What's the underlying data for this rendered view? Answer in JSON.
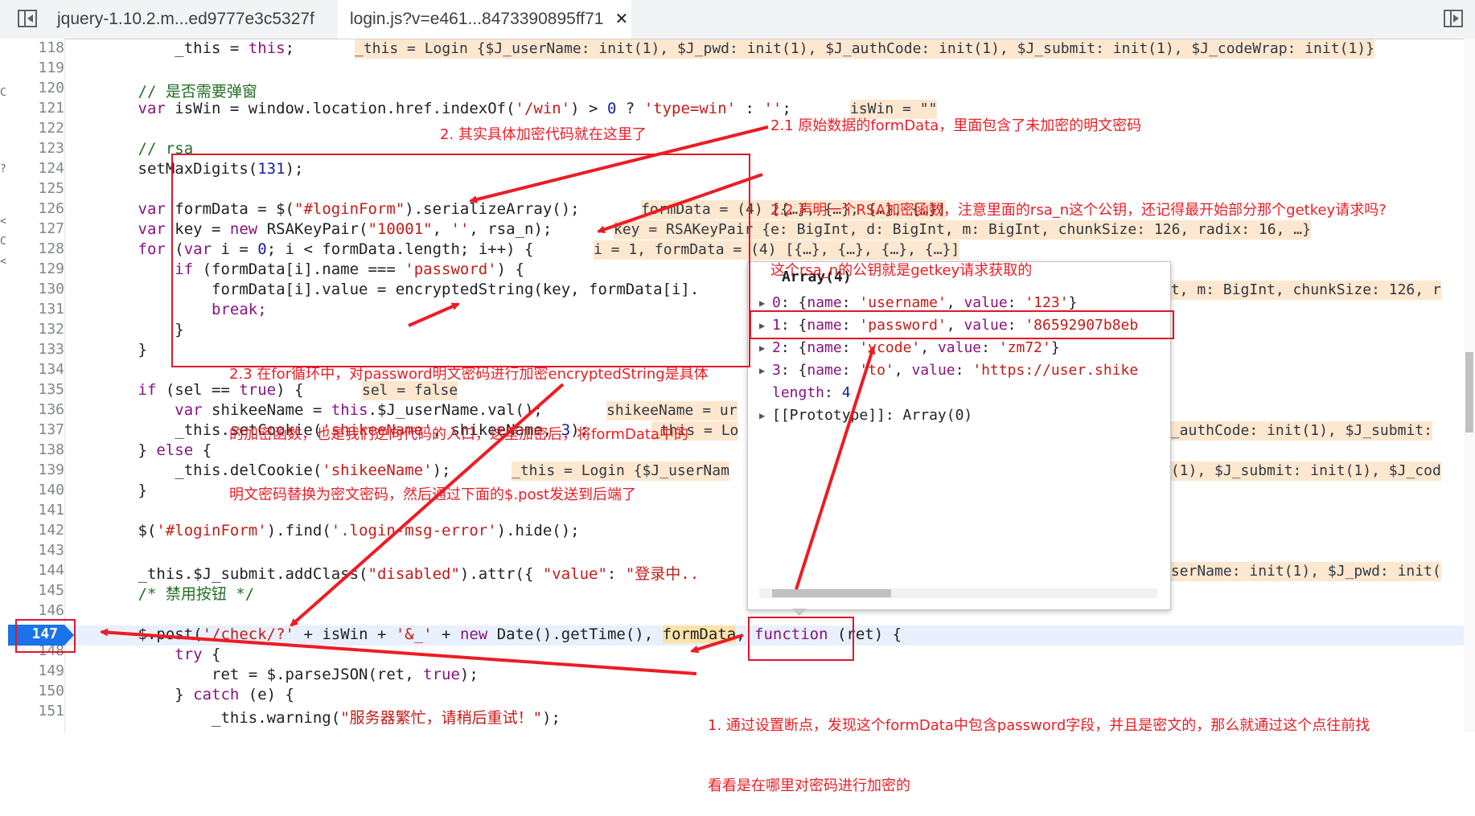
{
  "tabs": [
    {
      "label": "jquery-1.10.2.m...ed9777e3c5327f"
    },
    {
      "label": "login.js?v=e461...8473390895ff71",
      "close": "✕"
    }
  ],
  "line_numbers": [
    "118",
    "119",
    "120",
    "121",
    "122",
    "123",
    "124",
    "125",
    "126",
    "127",
    "128",
    "129",
    "130",
    "131",
    "132",
    "133",
    "134",
    "135",
    "136",
    "137",
    "138",
    "139",
    "140",
    "141",
    "142",
    "143",
    "144",
    "145",
    "146",
    "147",
    "148",
    "149",
    "150",
    "151"
  ],
  "breakpoint_line": "147",
  "left_strip_chars": [
    "C",
    "?",
    "<",
    "C",
    "<"
  ],
  "code": {
    "l118_a": "_this",
    "l118_b": " = ",
    "l118_c": "this",
    "l118_d": ";",
    "l120": "// 是否需要弹窗",
    "l121_a": "var",
    "l121_b": " isWin = window.location.href.indexOf(",
    "l121_c": "'/win'",
    "l121_d": ") > ",
    "l121_e": "0",
    "l121_f": " ? ",
    "l121_g": "'type=win'",
    "l121_h": " : ",
    "l121_i": "''",
    "l121_j": ";",
    "l123": "// rsa",
    "l124_a": "setMaxDigits(",
    "l124_b": "131",
    "l124_c": ");",
    "l126_a": "var",
    "l126_b": " formData = $(",
    "l126_c": "\"#loginForm\"",
    "l126_d": ").serializeArray();",
    "l127_a": "var",
    "l127_b": " key = ",
    "l127_c": "new",
    "l127_d": " RSAKeyPair(",
    "l127_e": "\"10001\"",
    "l127_f": ", ",
    "l127_g": "''",
    "l127_h": ", rsa_n);",
    "l128_a": "for",
    "l128_b": " (",
    "l128_c": "var",
    "l128_d": " i = ",
    "l128_e": "0",
    "l128_f": "; i < formData.length; i++) {",
    "l129_a": "    if",
    "l129_b": " (formData[i].name === ",
    "l129_c": "'password'",
    "l129_d": ") {",
    "l130": "        formData[i].value = encryptedString(key, formData[i].",
    "l131": "        break;",
    "l132": "    }",
    "l133": "}",
    "l135_a": "if",
    "l135_b": " (sel == ",
    "l135_c": "true",
    "l135_d": ") {",
    "l136_a": "    var",
    "l136_b": " shikeeName = ",
    "l136_c": "this",
    "l136_d": ".$J_userName.val();",
    "l137_a": "    _this.setCookie(",
    "l137_b": "'shikeeName'",
    "l137_c": ", shikeeName, ",
    "l137_d": "3",
    "l137_e": ");",
    "l138_a": "} ",
    "l138_b": "else",
    "l138_c": " {",
    "l139_a": "    _this.delCookie(",
    "l139_b": "'shikeeName'",
    "l139_c": ");",
    "l140": "}",
    "l142_a": "$(",
    "l142_b": "'#loginForm'",
    "l142_c": ").find(",
    "l142_d": "'.login-msg-error'",
    "l142_e": ").hide();",
    "l144_a": "_this.$J_submit.addClass(",
    "l144_b": "\"disabled\"",
    "l144_c": ").attr({ ",
    "l144_d": "\"value\"",
    "l144_e": ": ",
    "l144_f": "\"登录中..",
    "l145": "/* 禁用按钮 */",
    "l147_a": "$.",
    "l147_b": "post(",
    "l147_c": "'/check/?'",
    "l147_d": " + isWin + ",
    "l147_e": "'&_'",
    "l147_f": " + ",
    "l147_g": "new",
    "l147_h": " Date().",
    "l147_i": "getTime(), ",
    "l147_j": "formData",
    ", ": "",
    "l147_k": ", ",
    "l147_l": "function",
    "l147_m": " (ret) {",
    "l148_a": "    try",
    "l148_b": " {",
    "l149_a": "        ret = $.parseJSON(ret, ",
    "l149_b": "true",
    "l149_c": ");",
    "l150_a": "    } ",
    "l150_b": "catch",
    "l150_c": " (e) {",
    "l151_a": "        _this.warning(",
    "l151_b": "\"服务器繁忙，请稍后重试！\"",
    "l151_c": ");"
  },
  "inline_values": {
    "v118": "_this = Login {$J_userName: init(1), $J_pwd: init(1), $J_authCode: init(1), $J_submit: init(1), $J_codeWrap: init(1)}",
    "v121": "isWin = \"\"",
    "v126": "formData = (4) [{…}, {…}, {…}, {…}]",
    "v127": "key = RSAKeyPair {e: BigInt, d: BigInt, m: BigInt, chunkSize: 126, radix: 16, …}",
    "v128": "i = 1, formData = (4) [{…}, {…}, {…}, {…}]",
    "v130": "nt, m: BigInt, chunkSize: 126, r",
    "v135": "sel = false",
    "v136": "shikeeName = ur",
    "v137a": "_this = Lo",
    "v137b": "J_authCode: init(1), $J_submit:",
    "v139a": "_this = Login {$J_userNam",
    "v139b": "t(1), $J_submit: init(1), $J_cod",
    "v144": "userName: init(1), $J_pwd: init("
  },
  "popup": {
    "title": "Array(4)",
    "rows": [
      {
        "idx": "0",
        "sep": ": {",
        "k1": "name",
        "c1": ": ",
        "v1": "'username'",
        "c2": ", ",
        "k2": "value",
        "c3": ": ",
        "v2": "'123'",
        "end": "}"
      },
      {
        "idx": "1",
        "sep": ": {",
        "k1": "name",
        "c1": ": ",
        "v1": "'password'",
        "c2": ", ",
        "k2": "value",
        "c3": ": ",
        "v2": "'86592907b8eb",
        "end": ""
      },
      {
        "idx": "2",
        "sep": ": {",
        "k1": "name",
        "c1": ": ",
        "v1": "'vcode'",
        "c2": ", ",
        "k2": "value",
        "c3": ": ",
        "v2": "'zm72'",
        "end": "}"
      },
      {
        "idx": "3",
        "sep": ": {",
        "k1": "name",
        "c1": ": ",
        "v1": "'to'",
        "c2": ", ",
        "k2": "value",
        "c3": ": ",
        "v2": "'https://user.shike",
        "end": ""
      }
    ],
    "length_key": "length",
    "length_sep": ": ",
    "length_val": "4",
    "proto": "[[Prototype]]: Array(0)"
  },
  "annotations": {
    "a1_line1": "1. 通过设置断点，发现这个formData中包含password字段，并且是密文的，那么就通过这个点往前找",
    "a1_line2": "看看是在哪里对密码进行加密的",
    "a2": "2. 其实具体加密代码就在这里了",
    "a21": "2.1 原始数据的formData，里面包含了未加密的明文密码",
    "a22_line1": "2.2 声明一个RSA加密函数，注意里面的rsa_n这个公钥，还记得最开始部分那个getkey请求吗?",
    "a22_line2": "这个rsa_n的公钥就是getkey请求获取的",
    "a23_line1": "2.3 在for循环中，对password明文密码进行加密encryptedString是具体",
    "a23_line2": "的加密函数，也是我们逆向代码的入口，这里加密后，将formData中的",
    "a23_line3": "明文密码替换为密文密码，然后通过下面的$.post发送到后端了"
  },
  "colors": {
    "annotation": "#ed1c24",
    "breakpoint": "#1a73e8",
    "inline_value_bg": "#fde7cf",
    "paused_line": "#e8f0fe"
  }
}
